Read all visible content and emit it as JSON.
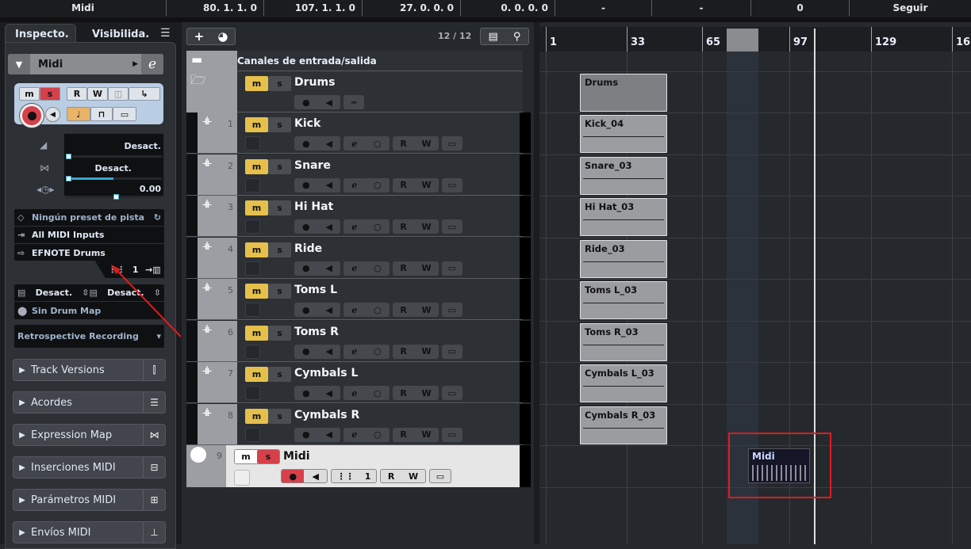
{
  "top_bar": {
    "cells": [
      {
        "text": "Midi"
      },
      {
        "text": "80. 1. 1.   0"
      },
      {
        "text": "107. 1. 1.   0"
      },
      {
        "text": "27. 0. 0.   0"
      },
      {
        "text": "0. 0. 0.   0"
      },
      {
        "text": "-"
      },
      {
        "text": "-"
      },
      {
        "text": "0"
      },
      {
        "text": "Seguir"
      }
    ]
  },
  "inspector": {
    "tabs": [
      "Inspecto.",
      "Visibilida."
    ],
    "menu_icon": "menu-icon",
    "track_name": "Midi",
    "buttons": {
      "mute": "m",
      "solo": "s",
      "read": "R",
      "write": "W"
    },
    "faders": {
      "volume": "Desact.",
      "pan": "Desact.",
      "delay": "0.00"
    },
    "preset": "Ningún preset de pista",
    "input": "All MIDI Inputs",
    "output": "EFNOTE Drums",
    "channel": "1",
    "bank": "Desact.",
    "program": "Desact.",
    "drum_map": "Sin Drum Map",
    "retro": "Retrospective Recording",
    "sections": [
      {
        "label": "Track Versions",
        "icon": "track-versions-icon"
      },
      {
        "label": "Acordes",
        "icon": "chords-icon"
      },
      {
        "label": "Expression Map",
        "icon": "expression-map-icon"
      },
      {
        "label": "Inserciones MIDI",
        "icon": "midi-inserts-icon"
      },
      {
        "label": "Parámetros MIDI",
        "icon": "midi-parameters-icon"
      },
      {
        "label": "Envíos MIDI",
        "icon": "midi-sends-icon"
      }
    ]
  },
  "track_list": {
    "count": "12 / 12",
    "io_folder": "Canales de entrada/salida",
    "folder": "Drums",
    "tracks": [
      {
        "num": "1",
        "name": "Kick"
      },
      {
        "num": "2",
        "name": "Snare"
      },
      {
        "num": "3",
        "name": "Hi Hat"
      },
      {
        "num": "4",
        "name": "Ride"
      },
      {
        "num": "5",
        "name": "Toms L"
      },
      {
        "num": "6",
        "name": "Toms R"
      },
      {
        "num": "7",
        "name": "Cymbals L"
      },
      {
        "num": "8",
        "name": "Cymbals R"
      }
    ],
    "midi_track": {
      "num": "9",
      "name": "Midi",
      "channel": "1"
    }
  },
  "arrange": {
    "ruler": [
      "1",
      "33",
      "65",
      "97",
      "129",
      "16"
    ],
    "clips": [
      "Drums",
      "Kick_04",
      "Snare_03",
      "Hi Hat_03",
      "Ride_03",
      "Toms L_03",
      "Toms R_03",
      "Cymbals L_03",
      "Cymbals R_03"
    ],
    "midi_clip": "Midi"
  },
  "colors": {
    "mute": "#e5c04b",
    "solo": "#d6404a",
    "highlight": "#e01c1c"
  }
}
